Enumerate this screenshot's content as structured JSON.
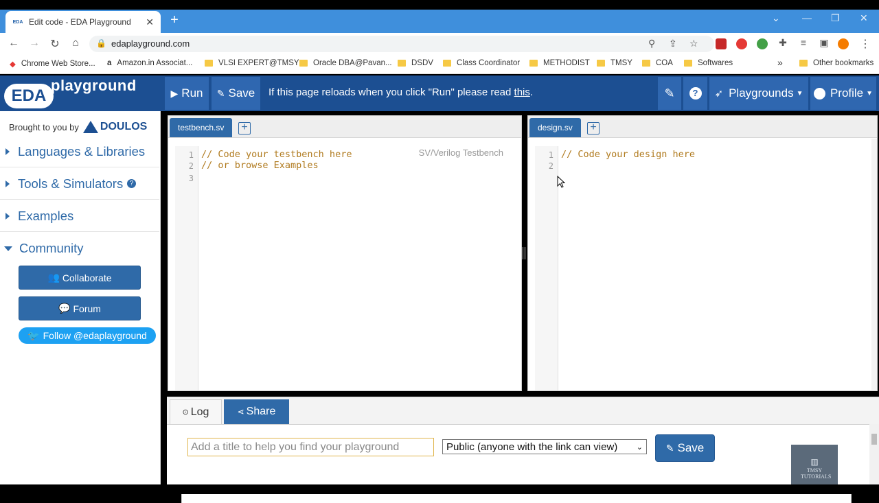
{
  "browser": {
    "tab_title": "Edit code - EDA Playground",
    "tab_favicon": "EDA",
    "url": "edaplayground.com",
    "bookmarks": [
      {
        "label": "Chrome Web Store...",
        "icon": "chrome-web-store-icon"
      },
      {
        "label": "Amazon.in Associat...",
        "icon": "amazon-icon"
      },
      {
        "label": "VLSI EXPERT@TMSY",
        "icon": "folder-icon"
      },
      {
        "label": "Oracle DBA@Pavan...",
        "icon": "folder-icon"
      },
      {
        "label": "DSDV",
        "icon": "folder-icon"
      },
      {
        "label": "Class Coordinator",
        "icon": "folder-icon"
      },
      {
        "label": "METHODIST",
        "icon": "folder-icon"
      },
      {
        "label": "TMSY",
        "icon": "folder-icon"
      },
      {
        "label": "COA",
        "icon": "folder-icon"
      },
      {
        "label": "Softwares",
        "icon": "folder-icon"
      }
    ],
    "more_bookmarks": "»",
    "other_bookmarks": "Other bookmarks"
  },
  "header": {
    "logo_eda": "EDA",
    "logo_playground": "playground",
    "run_label": "Run",
    "save_label": "Save",
    "message_prefix": "If this page reloads when you click \"Run\" please read ",
    "message_link": "this",
    "message_suffix": ".",
    "playgrounds_label": "Playgrounds",
    "profile_label": "Profile",
    "colors": {
      "bar": "#1c4f92",
      "button": "#2f67b0"
    }
  },
  "sidebar": {
    "brought_by": "Brought to you by",
    "sponsor": "DOULOS",
    "items": [
      {
        "label": "Languages & Libraries",
        "expanded": false
      },
      {
        "label": "Tools & Simulators",
        "expanded": false,
        "help": "?"
      },
      {
        "label": "Examples",
        "expanded": false
      },
      {
        "label": "Community",
        "expanded": true
      }
    ],
    "collaborate_label": "Collaborate",
    "forum_label": "Forum",
    "twitter_label": "Follow @edaplayground"
  },
  "editors": {
    "testbench": {
      "tab": "testbench.sv",
      "mode": "SV/Verilog Testbench",
      "lines": [
        "// Code your testbench here",
        "// or browse Examples",
        ""
      ],
      "line_numbers": [
        "1",
        "2",
        "3"
      ]
    },
    "design": {
      "tab": "design.sv",
      "lines": [
        "// Code your design here",
        ""
      ],
      "line_numbers": [
        "1",
        "2"
      ]
    }
  },
  "bottom": {
    "log_label": "Log",
    "share_label": "Share",
    "title_placeholder": "Add a title to help you find your playground",
    "visibility_value": "Public (anyone with the link can view)",
    "save_label": "Save",
    "thumbnail_text": "TMSY TUTORIALS"
  }
}
